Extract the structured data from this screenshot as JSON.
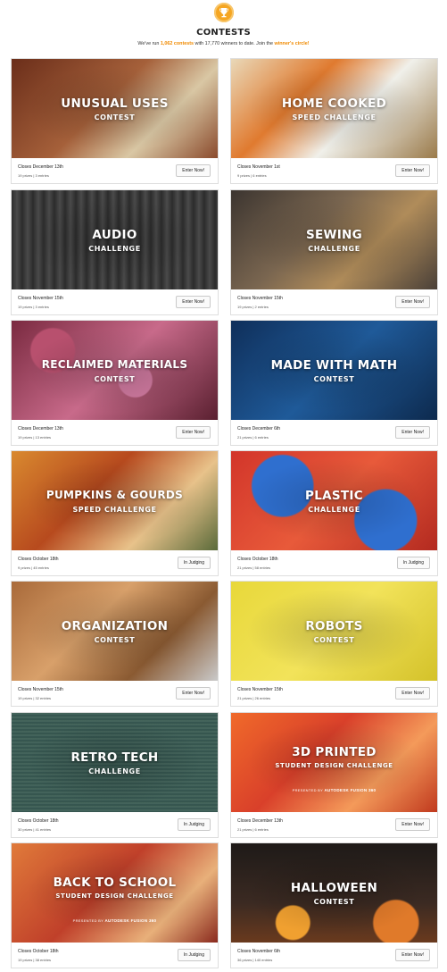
{
  "header": {
    "title": "CONTESTS",
    "subtitle_pre": "We've run ",
    "contest_count": "1,062 contests",
    "subtitle_mid": " with 17,770 winners to date. Join the ",
    "winners_link": "winner's circle!",
    "trophy_icon": "trophy-icon",
    "accent_color": "#f5a623"
  },
  "contests": [
    {
      "title": "UNUSUAL USES",
      "subtitle": "CONTEST",
      "closes": "Closes December 13th",
      "stats": "19 prizes  |  3 entries",
      "action": "Enter Now!",
      "theme": "#8a4a2c"
    },
    {
      "title": "HOME COOKED",
      "subtitle": "SPEED CHALLENGE",
      "closes": "Closes November 1st",
      "stats": "9 prizes  |  6 entries",
      "action": "Enter Now!",
      "theme": "#c7a35e"
    },
    {
      "title": "AUDIO",
      "subtitle": "CHALLENGE",
      "closes": "Closes November 15th",
      "stats": "19 prizes  |  3 entries",
      "action": "Enter Now!",
      "theme": "#3a3a3a"
    },
    {
      "title": "SEWING",
      "subtitle": "CHALLENGE",
      "closes": "Closes November 15th",
      "stats": "19 prizes  |  2 entries",
      "action": "Enter Now!",
      "theme": "#5b4c3c"
    },
    {
      "title": "RECLAIMED MATERIALS",
      "subtitle": "CONTEST",
      "closes": "Closes December 13th",
      "stats": "19 prizes  |  13 entries",
      "action": "Enter Now!",
      "theme": "#8e3d58"
    },
    {
      "title": "MADE WITH MATH",
      "subtitle": "CONTEST",
      "closes": "Closes December 6th",
      "stats": "21 prizes  |  6 entries",
      "action": "Enter Now!",
      "theme": "#1e4f8a"
    },
    {
      "title": "PUMPKINS & GOURDS",
      "subtitle": "SPEED CHALLENGE",
      "closes": "Closes October 18th",
      "stats": "9 prizes  |  45 entries",
      "action": "In Judging",
      "theme": "#c55a22"
    },
    {
      "title": "PLASTIC",
      "subtitle": "CHALLENGE",
      "closes": "Closes October 18th",
      "stats": "21 prizes  |  58 entries",
      "action": "In Judging",
      "theme": "#c73a2a"
    },
    {
      "title": "ORGANIZATION",
      "subtitle": "CONTEST",
      "closes": "Closes November 15th",
      "stats": "19 prizes  |  32 entries",
      "action": "Enter Now!",
      "theme": "#7a5232"
    },
    {
      "title": "ROBOTS",
      "subtitle": "CONTEST",
      "closes": "Closes November 15th",
      "stats": "21 prizes  |  26 entries",
      "action": "Enter Now!",
      "theme": "#d9c43a"
    },
    {
      "title": "RETRO TECH",
      "subtitle": "CHALLENGE",
      "closes": "Closes October 18th",
      "stats": "30 prizes  |  41 entries",
      "action": "In Judging",
      "theme": "#3f5a55"
    },
    {
      "title": "3D PRINTED",
      "subtitle": "STUDENT DESIGN CHALLENGE",
      "presented": "PRESENTED BY",
      "sponsor": "AUTODESK FUSION 360",
      "closes": "Closes December 13th",
      "stats": "21 prizes  |  6 entries",
      "action": "Enter Now!",
      "theme": "#d9502a"
    },
    {
      "title": "BACK TO SCHOOL",
      "subtitle": "STUDENT DESIGN CHALLENGE",
      "presented": "PRESENTED BY",
      "sponsor": "AUTODESK FUSION 360",
      "closes": "Closes October 18th",
      "stats": "19 prizes  |  38 entries",
      "action": "In Judging",
      "theme": "#b53a2a"
    },
    {
      "title": "HALLOWEEN",
      "subtitle": "CONTEST",
      "closes": "Closes November 6th",
      "stats": "36 prizes  |  140 entries",
      "action": "Enter Now!",
      "theme": "#3b2a22"
    }
  ]
}
